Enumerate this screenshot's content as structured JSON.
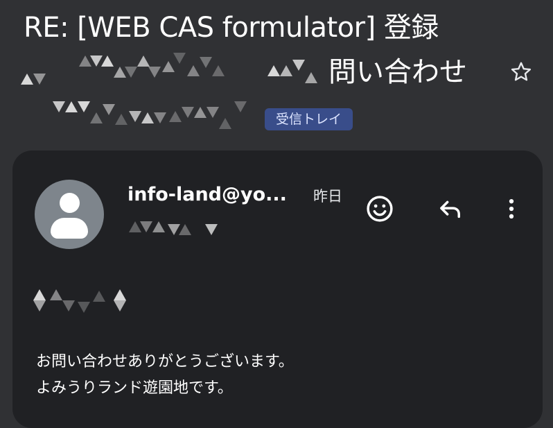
{
  "subject": {
    "title": "RE: [WEB CAS formulator] 登録",
    "title_cont": "問い合わせ"
  },
  "label": "受信トレイ",
  "message": {
    "sender": "info-land@yo...",
    "date": "昨日",
    "body_line1": "お問い合わせありがとうございます。",
    "body_line2": "よみうりランド遊園地です。"
  },
  "icons": {
    "star": "star-outline-icon",
    "emoji": "emoji-smile-icon",
    "reply": "reply-icon",
    "more": "more-vertical-icon"
  },
  "colors": {
    "background": "#303134",
    "card": "#202124",
    "label_chip": "#394d8a",
    "avatar": "#7e858c"
  }
}
